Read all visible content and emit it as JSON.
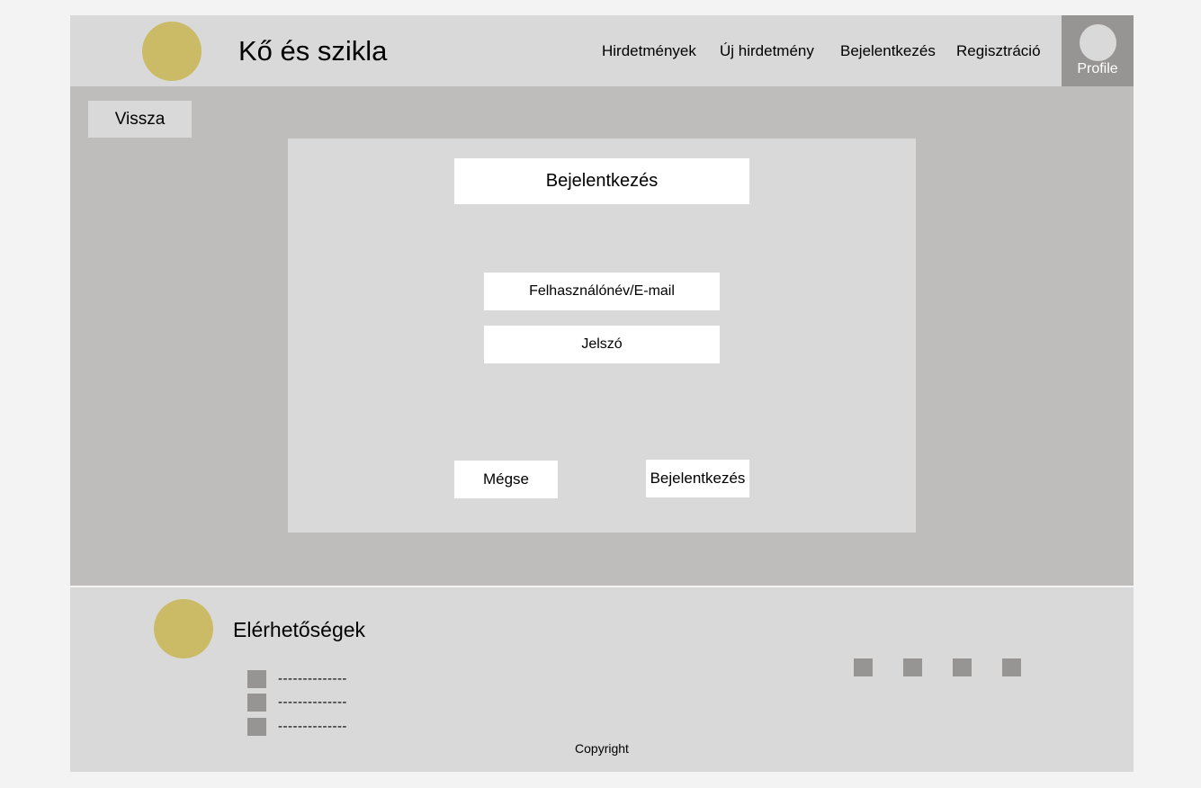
{
  "header": {
    "site_title": "Kő és szikla",
    "nav": [
      "Hirdetmények",
      "Új hirdetmény",
      "Bejelentkezés",
      "Regisztráció"
    ],
    "profile_label": "Profile"
  },
  "main": {
    "back_label": "Vissza",
    "login_title": "Bejelentkezés",
    "username_placeholder": "Felhasználónév/E-mail",
    "password_placeholder": "Jelszó",
    "cancel_label": "Mégse",
    "submit_label": "Bejelentkezés"
  },
  "footer": {
    "title": "Elérhetőségek",
    "contacts": [
      "--------------",
      "--------------",
      "--------------"
    ],
    "copyright": "Copyright"
  },
  "colors": {
    "accent_gold": "#cbbb66",
    "panel_gray": "#d9d9d9",
    "main_bg": "#bebdbb",
    "icon_gray": "#979494"
  }
}
